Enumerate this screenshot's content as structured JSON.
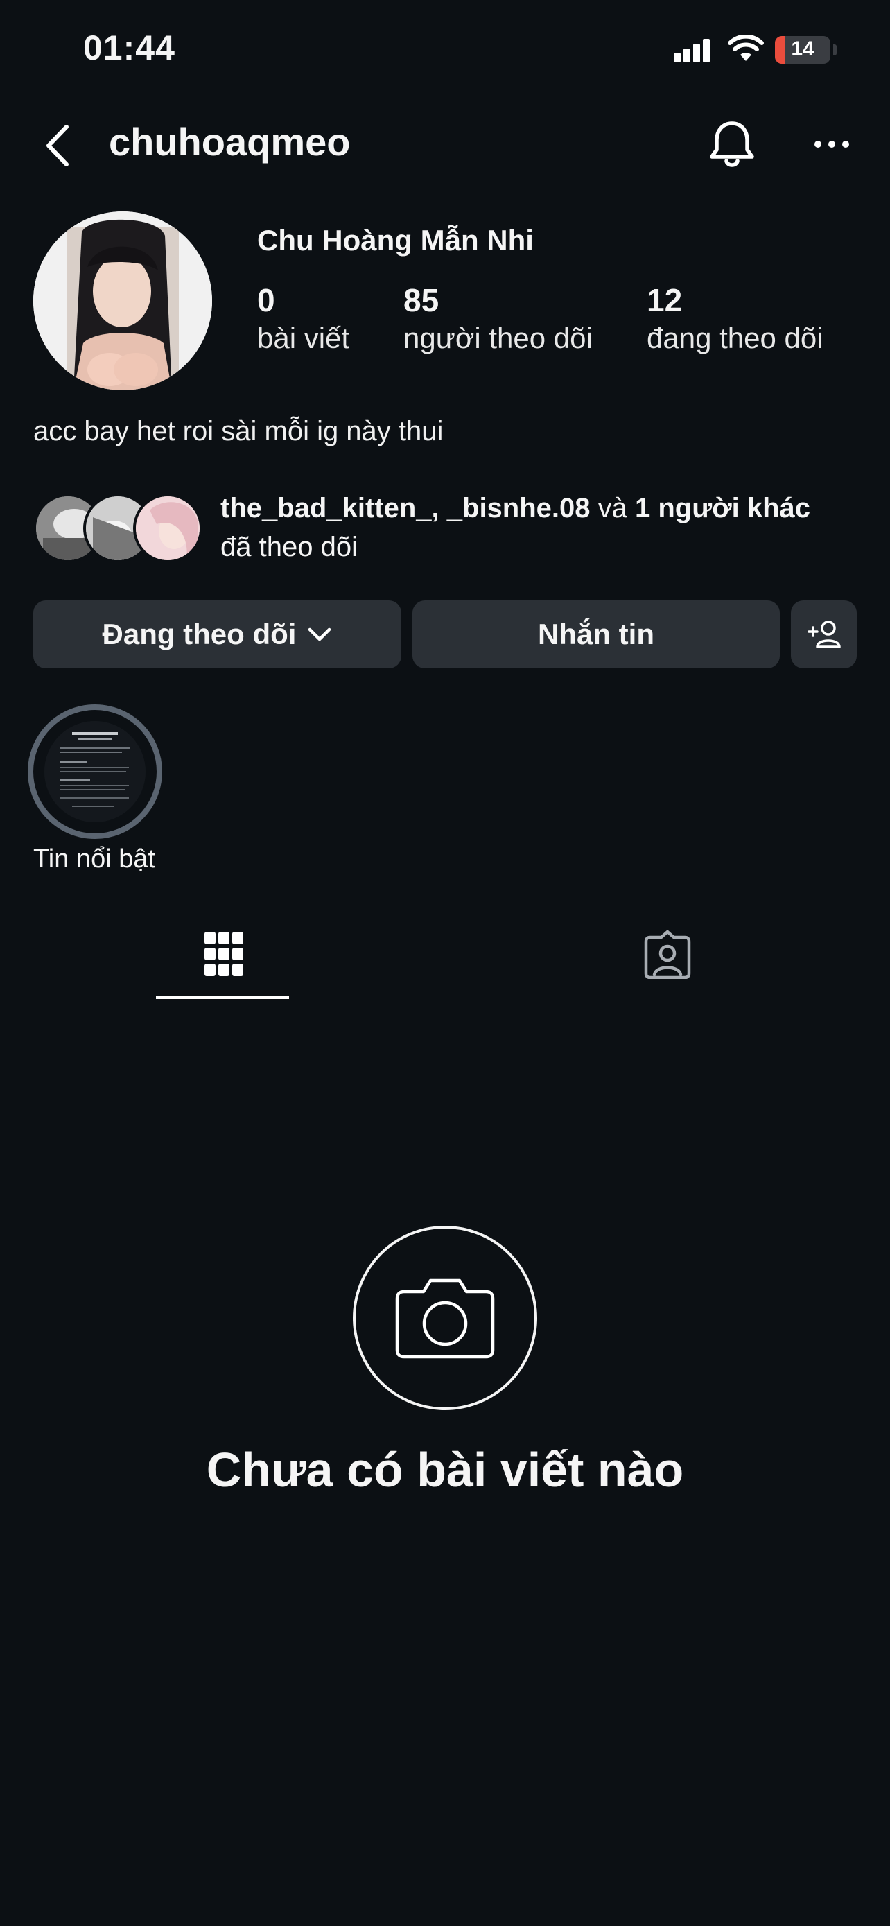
{
  "status_bar": {
    "time": "01:44",
    "battery": "14"
  },
  "header": {
    "username": "chuhoaqmeo"
  },
  "profile": {
    "display_name": "Chu Hoàng Mẫn Nhi",
    "stats": [
      {
        "value": "0",
        "label": "bài viết"
      },
      {
        "value": "85",
        "label": "người theo dõi"
      },
      {
        "value": "12",
        "label": "đang theo dõi"
      }
    ],
    "bio": "acc bay het roi sài mỗi ig này thui"
  },
  "mutual": {
    "names": "the_bad_kitten_, _bisnhe.08",
    "connector": " và ",
    "others": "1 người khác",
    "suffix": "đã theo dõi"
  },
  "actions": {
    "following": "Đang theo dõi",
    "message": "Nhắn tin"
  },
  "highlights": [
    {
      "label": "Tin nổi bật"
    }
  ],
  "tabs": {
    "active": "posts-grid"
  },
  "empty_state": {
    "title": "Chưa có bài viết nào"
  },
  "icons": [
    "back-icon",
    "bell-icon",
    "more-icon",
    "chevron-down-icon",
    "add-person-icon",
    "grid-icon",
    "tagged-icon",
    "camera-icon"
  ],
  "colors": {
    "background": "#0c1014",
    "button": "#2b3036",
    "battery_low": "#eb4d3d"
  }
}
